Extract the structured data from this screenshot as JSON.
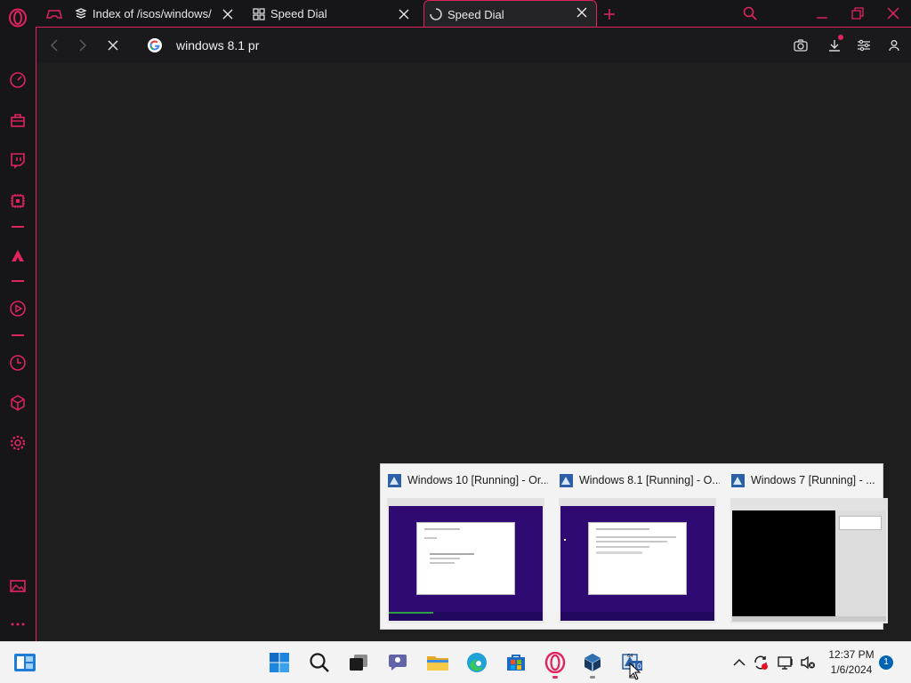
{
  "browser": {
    "tabs": [
      {
        "title": "Index of /isos/windows/"
      },
      {
        "title": "Speed Dial"
      },
      {
        "title": "Speed Dial"
      }
    ],
    "address": "windows 8.1 pr",
    "accent": "#e0245e"
  },
  "thumbnails": [
    {
      "title": "Windows 10 [Running] - Or..."
    },
    {
      "title": "Windows 8.1 [Running] - O..."
    },
    {
      "title": "Windows 7 [Running] - ..."
    }
  ],
  "taskbar": {
    "time": "12:37 PM",
    "date": "1/6/2024",
    "notifications": "1",
    "apps": [
      "widgets-icon",
      "start-icon",
      "search-icon",
      "task-view-icon",
      "teams-chat-icon",
      "file-explorer-icon",
      "edge-icon",
      "store-icon",
      "opera-icon",
      "virtualbox-icon",
      "virtualbox-vm-icon"
    ]
  }
}
